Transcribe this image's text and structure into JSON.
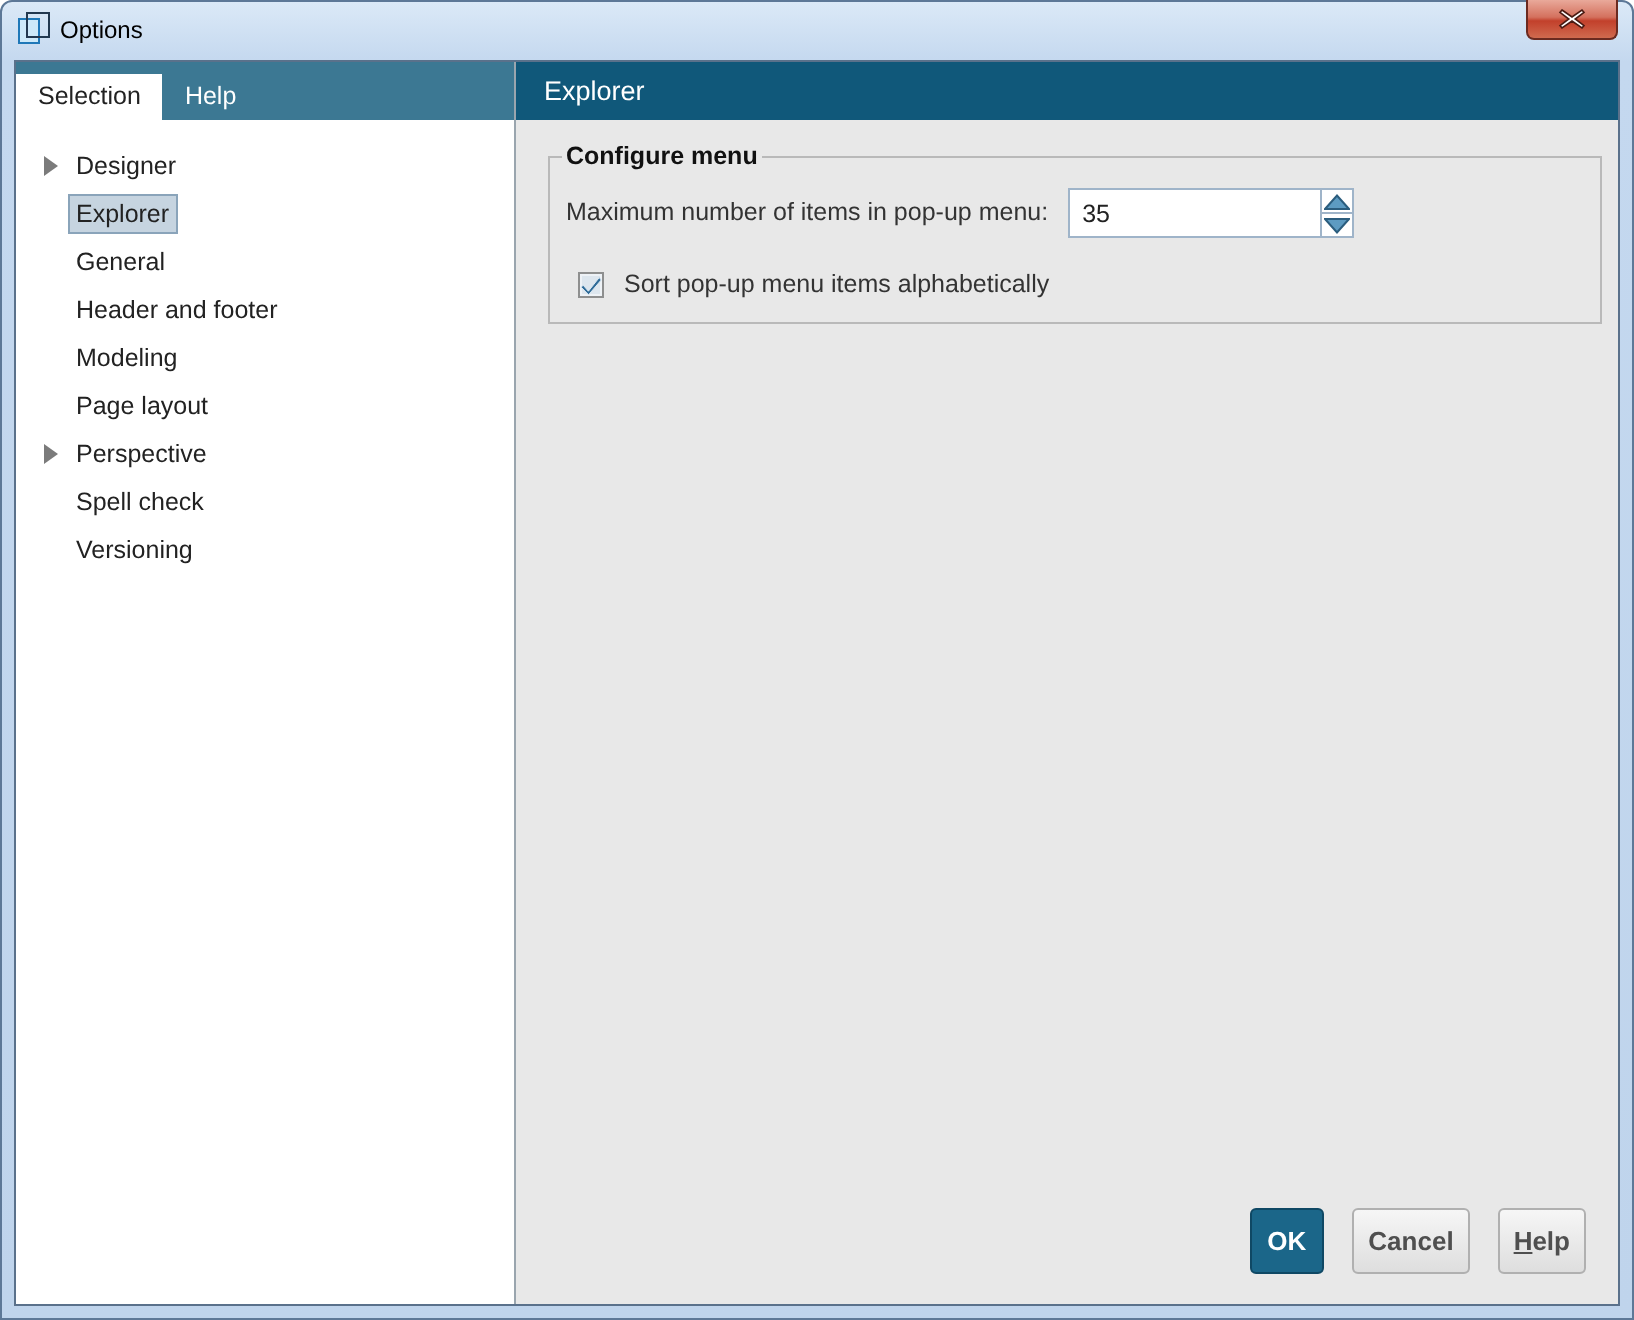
{
  "window": {
    "title": "Options"
  },
  "sidebar": {
    "tabs": [
      {
        "label": "Selection",
        "selected": true
      },
      {
        "label": "Help",
        "selected": false
      }
    ],
    "items": [
      {
        "label": "Designer",
        "expandable": true,
        "selected": false
      },
      {
        "label": "Explorer",
        "expandable": false,
        "selected": true
      },
      {
        "label": "General",
        "expandable": false,
        "selected": false
      },
      {
        "label": "Header and footer",
        "expandable": false,
        "selected": false
      },
      {
        "label": "Modeling",
        "expandable": false,
        "selected": false
      },
      {
        "label": "Page layout",
        "expandable": false,
        "selected": false
      },
      {
        "label": "Perspective",
        "expandable": true,
        "selected": false
      },
      {
        "label": "Spell check",
        "expandable": false,
        "selected": false
      },
      {
        "label": "Versioning",
        "expandable": false,
        "selected": false
      }
    ]
  },
  "panel": {
    "title": "Explorer",
    "group": {
      "title": "Configure menu",
      "fields": [
        {
          "kind": "spinner",
          "label": "Maximum number of items in pop-up menu:",
          "value": "35"
        },
        {
          "kind": "checkbox",
          "label": "Sort pop-up menu items alphabetically",
          "checked": true
        }
      ]
    }
  },
  "buttons": [
    {
      "label": "OK",
      "default": true,
      "access_key_underlined": false
    },
    {
      "label": "Cancel",
      "default": false,
      "access_key_underlined": false
    },
    {
      "label": "Help",
      "default": false,
      "access_key_underlined": true
    }
  ]
}
